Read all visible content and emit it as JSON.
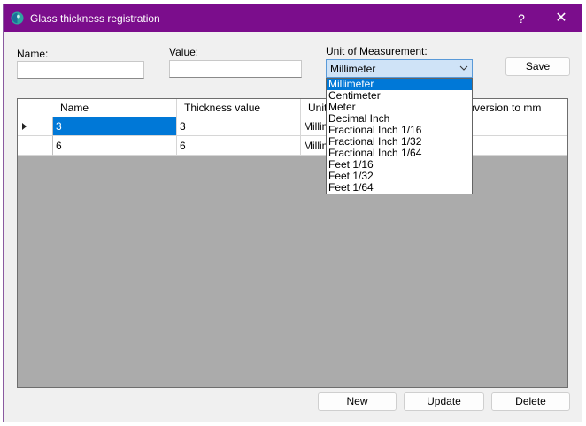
{
  "window": {
    "title": "Glass thickness registration",
    "help_label": "?",
    "close_label": "✕",
    "accent": "#7b0d8c"
  },
  "form": {
    "name_label": "Name:",
    "name_value": "",
    "value_label": "Value:",
    "value_value": "",
    "unit_label": "Unit of Measurement:",
    "unit_selected": "Millimeter",
    "save_label": "Save"
  },
  "grid": {
    "columns": [
      "Name",
      "Thickness value",
      "Unit",
      "Conversion to mm"
    ],
    "rows": [
      {
        "name": "3",
        "thickness": "3",
        "unit": "Millim"
      },
      {
        "name": "6",
        "thickness": "6",
        "unit": "Millim"
      }
    ]
  },
  "dropdown": {
    "options": [
      "Millimeter",
      "Centimeter",
      "Meter",
      "Decimal Inch",
      "Fractional Inch 1/16",
      "Fractional Inch 1/32",
      "Fractional Inch 1/64",
      "Feet 1/16",
      "Feet 1/32",
      "Feet 1/64"
    ],
    "selected_index": 0
  },
  "buttons": {
    "new_label": "New",
    "update_label": "Update",
    "delete_label": "Delete"
  }
}
